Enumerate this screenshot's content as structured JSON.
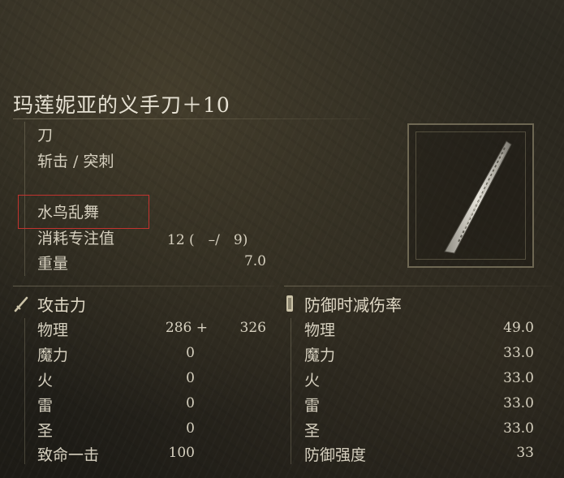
{
  "weapon": {
    "name": "玛莲妮亚的义手刀＋10",
    "type": "刀",
    "attack_type": "斩击 / 突刺",
    "skill": "水鸟乱舞",
    "fp_cost_label": "消耗专注值",
    "fp_cost_value": "12 (　–/　9)",
    "weight_label": "重量",
    "weight_value": "7.0"
  },
  "attack": {
    "header": "攻击力",
    "rows": [
      {
        "label": "物理",
        "value": "286 +",
        "bonus": "326"
      },
      {
        "label": "魔力",
        "value": "0"
      },
      {
        "label": "火",
        "value": "0"
      },
      {
        "label": "雷",
        "value": "0"
      },
      {
        "label": "圣",
        "value": "0"
      },
      {
        "label": "致命一击",
        "value": "100"
      }
    ]
  },
  "defense": {
    "header": "防御时减伤率",
    "rows": [
      {
        "label": "物理",
        "value": "49.0"
      },
      {
        "label": "魔力",
        "value": "33.0"
      },
      {
        "label": "火",
        "value": "33.0"
      },
      {
        "label": "雷",
        "value": "33.0"
      },
      {
        "label": "圣",
        "value": "33.0"
      },
      {
        "label": "防御强度",
        "value": "33"
      }
    ]
  },
  "highlight_color": "#c2332f",
  "icons": {
    "attack": "sword-icon",
    "defense": "shield-icon",
    "weapon_image": "katana-blade-icon"
  }
}
